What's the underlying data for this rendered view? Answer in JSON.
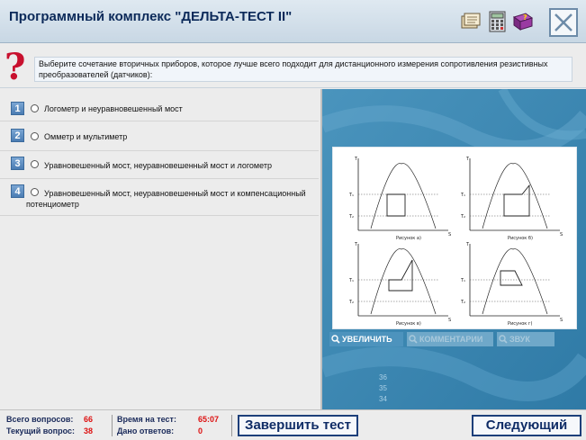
{
  "header": {
    "title": "Программный комплекс \"ДЕЛЬТА-ТЕСТ II\""
  },
  "question": {
    "text": "Выберите сочетание вторичных приборов, которое лучше всего подходит для дистанционного измерения сопротивления резистивных преобразователей (датчиков):"
  },
  "answers": [
    {
      "number": "1",
      "text": "Логометр и неуравновешенный мост"
    },
    {
      "number": "2",
      "text": "Омметр и мультиметр"
    },
    {
      "number": "3",
      "text": "Уравновешенный мост, неуравновешенный мост и логометр"
    },
    {
      "number": "4",
      "text_line1": "Уравновешенный мост, неуравновешенный мост и компенсационный",
      "text_line2": "потенциометр"
    }
  ],
  "figure": {
    "axis_t": "T",
    "axis_s": "S",
    "t1": "T₁",
    "t2": "T₂",
    "captions": [
      "Рисунок а)",
      "Рисунок б)",
      "Рисунок в)",
      "Рисунок г)"
    ]
  },
  "media_toolbar": {
    "zoom": "УВЕЛИЧИТЬ",
    "comments": "КОММЕНТАРИИ",
    "sound": "ЗВУК"
  },
  "faded_numbers": [
    "36",
    "35",
    "34"
  ],
  "footer": {
    "total_label": "Всего вопросов:",
    "total_value": "66",
    "current_label": "Текущий вопрос:",
    "current_value": "38",
    "time_label": "Время на тест:",
    "time_value": "65:07",
    "answered_label": "Дано ответов:",
    "answered_value": "0",
    "finish_button": "Завершить тест",
    "next_button": "Следующий"
  },
  "colors": {
    "accent": "#0f2c66",
    "panel_blue": "#3a83ad",
    "value_red": "#dd1111"
  }
}
